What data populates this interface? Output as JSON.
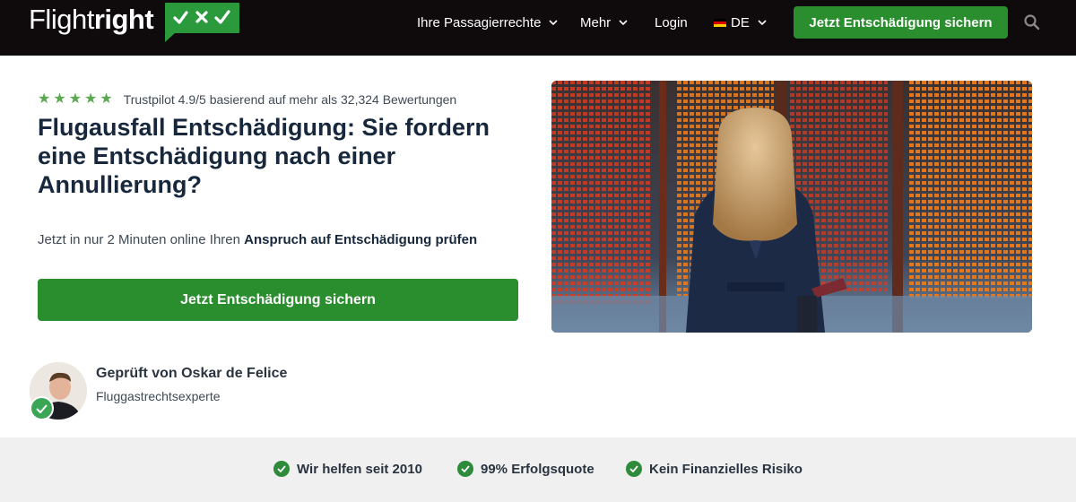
{
  "brand": {
    "name_light": "Flight",
    "name_bold": "right",
    "accent": "#2a9a3c"
  },
  "nav": {
    "items": [
      {
        "label": "Ihre Passagierrechte",
        "has_dropdown": true
      },
      {
        "label": "Mehr",
        "has_dropdown": true
      },
      {
        "label": "Login",
        "has_dropdown": false
      }
    ],
    "language": {
      "label": "DE",
      "icon": "german-flag-icon",
      "has_dropdown": true
    },
    "cta_label": "Jetzt Entschädigung sichern",
    "search_icon": "search-icon"
  },
  "hero": {
    "rating": {
      "stars": 5,
      "text": "Trustpilot 4.9/5 basierend auf mehr als 32,324 Bewertungen"
    },
    "title": "Flugausfall Entschädigung: Sie fordern eine Entschädigung nach einer Annullierung?",
    "subtitle_prefix": "Jetzt in nur 2 Minuten online Ihren ",
    "subtitle_bold": "Anspruch auf Entschädigung prüfen",
    "cta_label": "Jetzt Entschädigung sichern"
  },
  "reviewer": {
    "name": "Geprüft von Oskar de Felice",
    "role": "Fluggastrechtsexperte"
  },
  "usps": [
    {
      "label": "Wir helfen seit 2010"
    },
    {
      "label": "99% Erfolgsquote"
    },
    {
      "label": "Kein Finanzielles Risiko"
    }
  ],
  "colors": {
    "topbar": "#0f0a0b",
    "button_green": "#2a8d2e",
    "heading": "#17283c",
    "strip": "#f0f0f0"
  }
}
